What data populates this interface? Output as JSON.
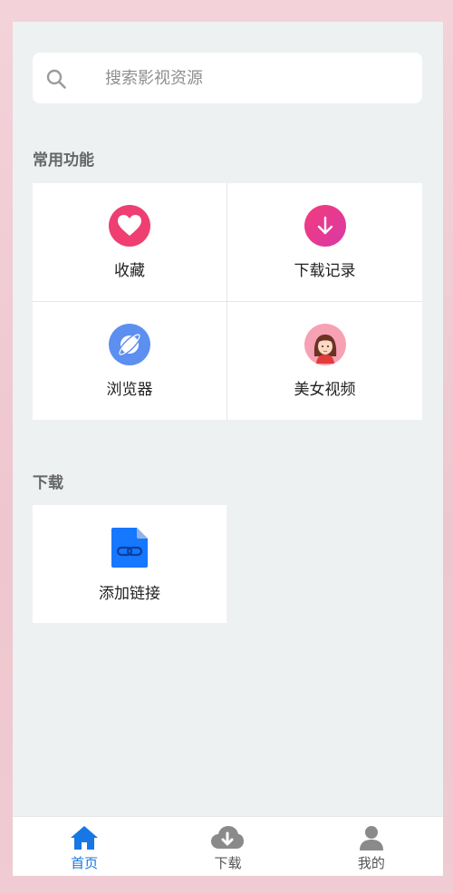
{
  "search": {
    "placeholder": "搜索影视资源",
    "icon": "search-icon"
  },
  "sections": {
    "common": {
      "title": "常用功能",
      "items": [
        {
          "label": "收藏",
          "icon": "heart-icon",
          "color": "#ef3e72"
        },
        {
          "label": "下载记录",
          "icon": "download-arrow-icon",
          "color": "#ec3a8e"
        },
        {
          "label": "浏览器",
          "icon": "planet-browser-icon",
          "color": "#5c8ff0"
        },
        {
          "label": "美女视频",
          "icon": "girl-avatar-icon",
          "color": "#f79bb0"
        }
      ]
    },
    "download": {
      "title": "下载",
      "items": [
        {
          "label": "添加链接",
          "icon": "link-file-icon",
          "color": "#1677ff"
        }
      ]
    }
  },
  "tabbar": {
    "items": [
      {
        "label": "首页",
        "icon": "home-icon",
        "active": true
      },
      {
        "label": "下载",
        "icon": "cloud-download-icon",
        "active": false
      },
      {
        "label": "我的",
        "icon": "user-icon",
        "active": false
      }
    ],
    "active_color": "#1677e5"
  }
}
